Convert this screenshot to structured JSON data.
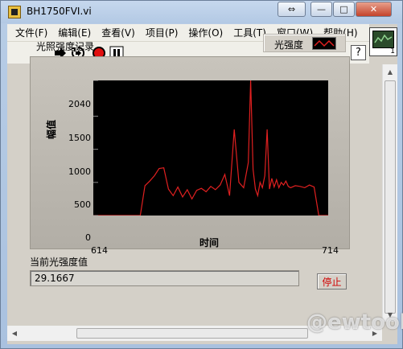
{
  "window": {
    "title": "BH1750FVI.vi",
    "buttons": {
      "restore": "⇔",
      "minimize": "—",
      "maximize": "□",
      "close": "✕"
    }
  },
  "menu": {
    "items": [
      "文件(F)",
      "编辑(E)",
      "查看(V)",
      "项目(P)",
      "操作(O)",
      "工具(T)",
      "窗口(W)",
      "帮助(H)"
    ]
  },
  "toolbar": {
    "run_icon": "run-arrow-icon",
    "continuous_icon": "continuous-run-icon",
    "abort_icon": "abort-icon",
    "pause_icon": "pause-icon",
    "help": "?"
  },
  "vi_icon": {
    "number": "1"
  },
  "chart": {
    "title": "光照强度记录",
    "legend_label": "光强度",
    "ylabel": "幅值",
    "xlabel": "时间"
  },
  "readout": {
    "label": "当前光强度值",
    "value": "29.1667"
  },
  "stop_button": {
    "label": "停止"
  },
  "colors": {
    "trace": "#e02020",
    "plot_bg": "#000000"
  },
  "chart_data": {
    "type": "line",
    "title": "光照强度记录",
    "xlabel": "时间",
    "ylabel": "幅值",
    "xlim": [
      614,
      714
    ],
    "ylim": [
      0,
      2040
    ],
    "y_ticks": [
      0,
      500,
      1000,
      1500,
      2040
    ],
    "x_ticks": [
      614,
      714
    ],
    "series": [
      {
        "name": "光强度",
        "x": [
          614,
          634,
          636,
          638,
          640,
          642,
          644,
          646,
          648,
          650,
          652,
          654,
          656,
          658,
          660,
          662,
          664,
          666,
          668,
          670,
          672,
          674,
          676,
          678,
          680,
          681,
          682,
          683,
          684,
          685,
          686,
          687,
          688,
          689,
          690,
          691,
          692,
          693,
          694,
          695,
          696,
          697,
          698,
          700,
          702,
          704,
          706,
          708,
          710,
          714
        ],
        "y": [
          0,
          0,
          450,
          520,
          600,
          710,
          720,
          400,
          300,
          430,
          280,
          390,
          250,
          380,
          410,
          360,
          440,
          390,
          460,
          620,
          300,
          1300,
          500,
          420,
          800,
          2040,
          700,
          400,
          300,
          500,
          420,
          600,
          1300,
          400,
          560,
          430,
          540,
          420,
          500,
          460,
          520,
          440,
          420,
          450,
          440,
          420,
          460,
          430,
          0,
          0
        ]
      }
    ],
    "grid": false,
    "legend": "top-right"
  }
}
